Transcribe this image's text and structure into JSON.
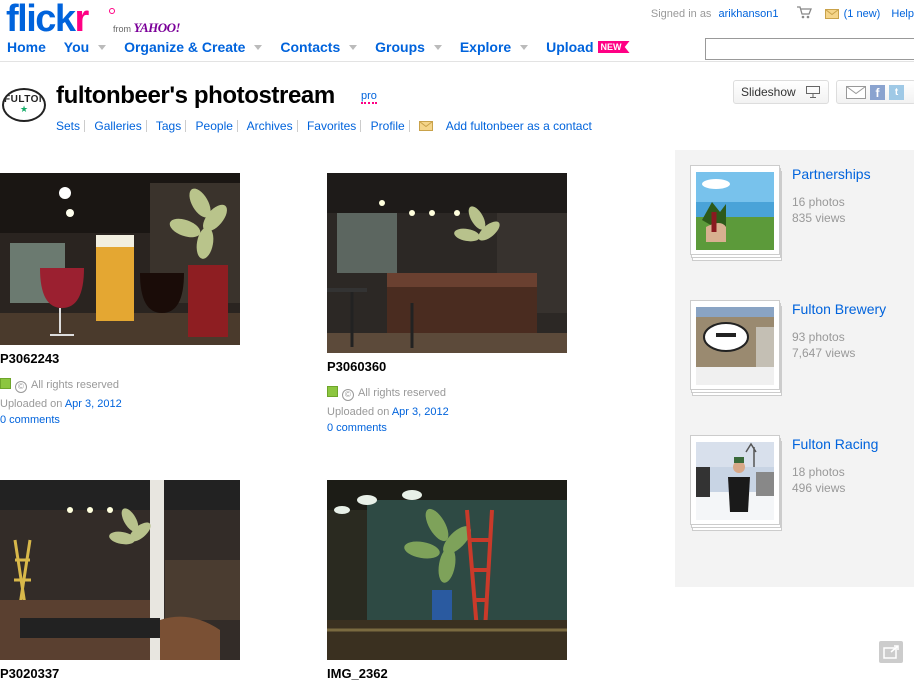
{
  "header": {
    "logo_text_blue": "flick",
    "logo_text_pink": "r",
    "logo_from": "from",
    "logo_yahoo": "YAHOO!",
    "signed_in_label": "Signed in as",
    "username": "arikhanson1",
    "mail_count": "(1 new)",
    "help_label": "Help"
  },
  "nav": {
    "items": [
      {
        "label": "Home",
        "has_caret": false
      },
      {
        "label": "You",
        "has_caret": true
      },
      {
        "label": "Organize & Create",
        "has_caret": true
      },
      {
        "label": "Contacts",
        "has_caret": true
      },
      {
        "label": "Groups",
        "has_caret": true
      },
      {
        "label": "Explore",
        "has_caret": true
      },
      {
        "label": "Upload",
        "has_caret": false
      }
    ],
    "upload_badge": "NEW",
    "search_placeholder": ""
  },
  "profile": {
    "avatar_text": "FULTON",
    "avatar_sub": "★",
    "title": "fultonbeer's photostream",
    "pro_label": "pro",
    "subnav": [
      "Sets",
      "Galleries",
      "Tags",
      "People",
      "Archives",
      "Favorites",
      "Profile"
    ],
    "add_contact": "Add fultonbeer as a contact",
    "slideshow_label": "Slideshow",
    "fb_glyph": "f",
    "tw_glyph": "t"
  },
  "photos": [
    {
      "title": "P3062243",
      "license": "All rights reserved",
      "uploaded_prefix": "Uploaded on",
      "date": "Apr 3, 2012",
      "comments": "0 comments"
    },
    {
      "title": "P3060360",
      "license": "All rights reserved",
      "uploaded_prefix": "Uploaded on",
      "date": "Apr 3, 2012",
      "comments": "0 comments"
    },
    {
      "title": "P3020337",
      "license": "",
      "uploaded_prefix": "",
      "date": "",
      "comments": ""
    },
    {
      "title": "IMG_2362",
      "license": "",
      "uploaded_prefix": "",
      "date": "",
      "comments": ""
    }
  ],
  "sets": [
    {
      "name": "Partnerships",
      "photos": "16 photos",
      "views": "835 views"
    },
    {
      "name": "Fulton Brewery",
      "photos": "93 photos",
      "views": "7,647 views"
    },
    {
      "name": "Fulton Racing",
      "photos": "18 photos",
      "views": "496 views"
    }
  ],
  "colors": {
    "flickr_blue": "#0063dc",
    "flickr_pink": "#ff0084",
    "license_green": "#8cc63f",
    "sidebar_bg": "#f3f3f3"
  },
  "icons": [
    "cart-icon",
    "mail-icon",
    "slideshow-screen-icon",
    "email-share-icon",
    "facebook-icon",
    "twitter-icon",
    "share-corner-icon",
    "creative-commons-icon"
  ]
}
